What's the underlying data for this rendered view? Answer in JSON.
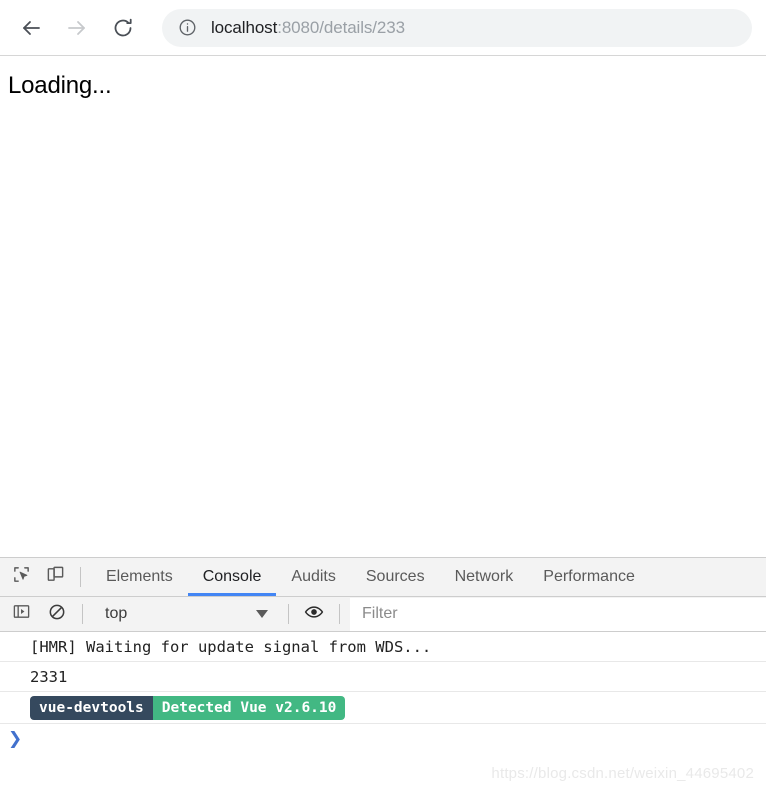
{
  "browser": {
    "back_icon": "arrow-left-icon",
    "forward_icon": "arrow-right-icon",
    "reload_icon": "reload-icon",
    "site_info_icon": "info-circle-icon",
    "url_host": "localhost",
    "url_path": ":8080/details/233",
    "url_full": "localhost:8080/details/233"
  },
  "page": {
    "body_text": "Loading..."
  },
  "devtools": {
    "inspect_icon": "inspect-element-icon",
    "device_icon": "device-toolbar-icon",
    "tabs": [
      {
        "label": "Elements",
        "active": false
      },
      {
        "label": "Console",
        "active": true
      },
      {
        "label": "Audits",
        "active": false
      },
      {
        "label": "Sources",
        "active": false
      },
      {
        "label": "Network",
        "active": false
      },
      {
        "label": "Performance",
        "active": false
      }
    ],
    "active_tab": "Console",
    "accent_color": "#4285f4",
    "console_toolbar": {
      "sidebar_toggle_icon": "console-sidebar-icon",
      "clear_icon": "clear-console-icon",
      "context_value": "top",
      "caret_icon": "chevron-down-icon",
      "eye_icon": "live-expression-eye-icon",
      "filter_placeholder": "Filter",
      "filter_value": ""
    },
    "console_messages": [
      {
        "text": "[HMR] Waiting for update signal from WDS...",
        "type": "log"
      },
      {
        "text": "2331",
        "type": "log"
      }
    ],
    "vue_badge": {
      "left_text": "vue-devtools",
      "right_text": "Detected Vue v2.6.10",
      "left_color": "#35495e",
      "right_color": "#42b883"
    },
    "prompt_symbol": "❯"
  },
  "watermark": {
    "text": "https://blog.csdn.net/weixin_44695402"
  }
}
